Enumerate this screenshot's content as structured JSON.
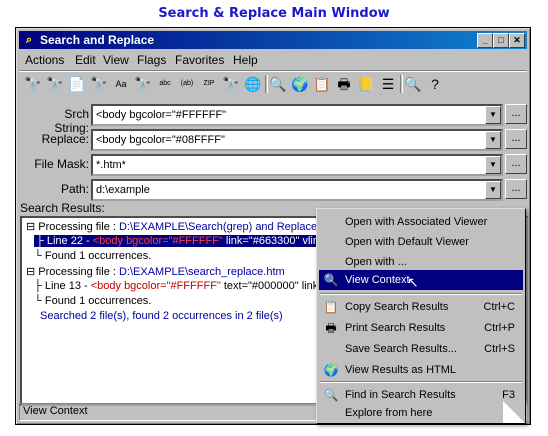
{
  "caption": "Search & Replace Main Window",
  "window": {
    "title": "Search and Replace"
  },
  "menu": [
    "Actions",
    "Edit",
    "View",
    "Flags",
    "Favorites",
    "Help"
  ],
  "toolbar": [
    {
      "name": "binoculars-icon",
      "glyph": "🔭"
    },
    {
      "name": "binoculars-purple-icon",
      "glyph": "🔭"
    },
    {
      "name": "find-file-icon",
      "glyph": "📄"
    },
    {
      "name": "binoculars-yellow-icon",
      "glyph": "🔭"
    },
    {
      "name": "find-replace-aa-icon",
      "glyph": "Aa"
    },
    {
      "name": "binoculars-2-icon",
      "glyph": "🔭"
    },
    {
      "name": "replace-abc-icon",
      "glyph": "abc"
    },
    {
      "name": "replace-regex-icon",
      "glyph": "(ab)"
    },
    {
      "name": "zip-icon",
      "glyph": "ZIP"
    },
    {
      "name": "binoculars-3-icon",
      "glyph": "🔭"
    },
    {
      "name": "web-search-icon",
      "glyph": "🌐"
    },
    {
      "name": "view-context-icon",
      "glyph": "🔍"
    },
    {
      "name": "globe-icon",
      "glyph": "🌍"
    },
    {
      "name": "copy-icon",
      "glyph": "📋"
    },
    {
      "name": "print-icon",
      "glyph": "🖶"
    },
    {
      "name": "notes-icon",
      "glyph": "📒"
    },
    {
      "name": "list-icon",
      "glyph": "☰"
    },
    {
      "name": "find-settings-icon",
      "glyph": "🔍"
    },
    {
      "name": "help-icon",
      "glyph": "?"
    }
  ],
  "fields": {
    "search_label": "Srch String:",
    "search_value": "<body bgcolor=\"#FFFFFF\"",
    "replace_label": "Replace:",
    "replace_value": "<body bgcolor=\"#08FFFF\"",
    "mask_label": "File Mask:",
    "mask_value": "*.htm*",
    "path_label": "Path:",
    "path_value": "d:\\example",
    "browse_label": "..."
  },
  "results": {
    "label": "Search Results:",
    "file1_prefix": "Processing file : ",
    "file1_path": "D:\\EXAMPLE\\Search(grep) and Replace I",
    "line22_prefix": "Line  22 - ",
    "line22_match": "<body bgcolor=\"#FFFFFF\"",
    "line22_rest": " link=\"#663300\" vlink",
    "found1": "Found 1 occurrences.",
    "file2_prefix": "Processing file : ",
    "file2_path": "D:\\EXAMPLE\\search_replace.htm",
    "line13_prefix": "Line  13 - ",
    "line13_match": "<body bgcolor=\"#FFFFFF\"",
    "line13_rest": " text=\"#000000\" link=",
    "found2": "Found 1 occurrences.",
    "summary": "Searched 2 file(s), found 2 occurrences in 2 file(s)"
  },
  "status": "View Context",
  "context_menu": {
    "open_assoc": "Open with Associated Viewer",
    "open_default": "Open with Default Viewer",
    "open_with": "Open with ...",
    "view_context": "View Context",
    "copy_results": "Copy Search Results",
    "copy_key": "Ctrl+C",
    "print_results": "Print Search Results",
    "print_key": "Ctrl+P",
    "save_results": "Save Search Results...",
    "save_key": "Ctrl+S",
    "view_html": "View Results as HTML",
    "find_in_results": "Find in Search Results",
    "find_key": "F3",
    "explore": "Explore from here"
  },
  "colors": {
    "title_bar": "#000080",
    "selection": "#000080",
    "match_red": "#c00000",
    "path_blue": "#0000a0",
    "caption": "#1a1acc"
  }
}
